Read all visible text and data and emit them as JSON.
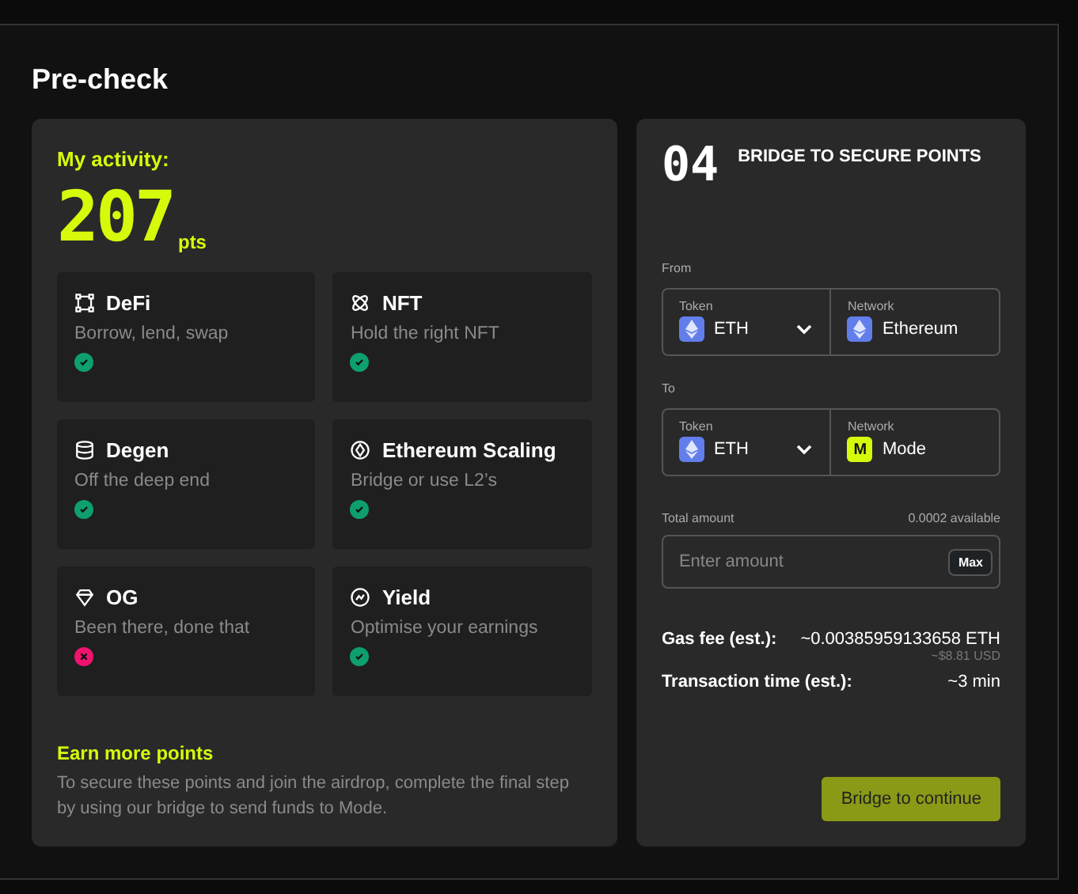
{
  "title": "Pre-check",
  "activity": {
    "heading": "My activity:",
    "points": "207",
    "unit": "pts",
    "categories": [
      {
        "name": "DeFi",
        "description": "Borrow, lend, swap",
        "done": true
      },
      {
        "name": "NFT",
        "description": "Hold the right NFT",
        "done": true
      },
      {
        "name": "Degen",
        "description": "Off the deep end",
        "done": true
      },
      {
        "name": "Ethereum Scaling",
        "description": "Bridge or use L2’s",
        "done": true
      },
      {
        "name": "OG",
        "description": "Been there, done that",
        "done": false
      },
      {
        "name": "Yield",
        "description": "Optimise your earnings",
        "done": true
      }
    ],
    "earn_heading": "Earn more points",
    "earn_text": "To secure these points and join the airdrop, complete the final step by using our bridge to send funds to Mode."
  },
  "bridge": {
    "step": "04",
    "title": "BRIDGE TO SECURE POINTS",
    "routes": [
      {
        "label": "From",
        "token_label": "Token",
        "token": "ETH",
        "network_label": "Network",
        "network": "Ethereum",
        "kind": "eth"
      },
      {
        "label": "To",
        "token_label": "Token",
        "token": "ETH",
        "network_label": "Network",
        "network": "Mode",
        "kind": "mode",
        "network_badge": "M"
      }
    ],
    "amount_label": "Total amount",
    "available": "0.0002 available",
    "amount_placeholder": "Enter amount",
    "max_button": "Max",
    "gas_label": "Gas fee (est.):",
    "gas_value": "~0.00385959133658 ETH",
    "gas_usd": "~$8.81 USD",
    "time_label": "Transaction time (est.):",
    "time_value": "~3 min",
    "submit": "Bridge to continue"
  }
}
